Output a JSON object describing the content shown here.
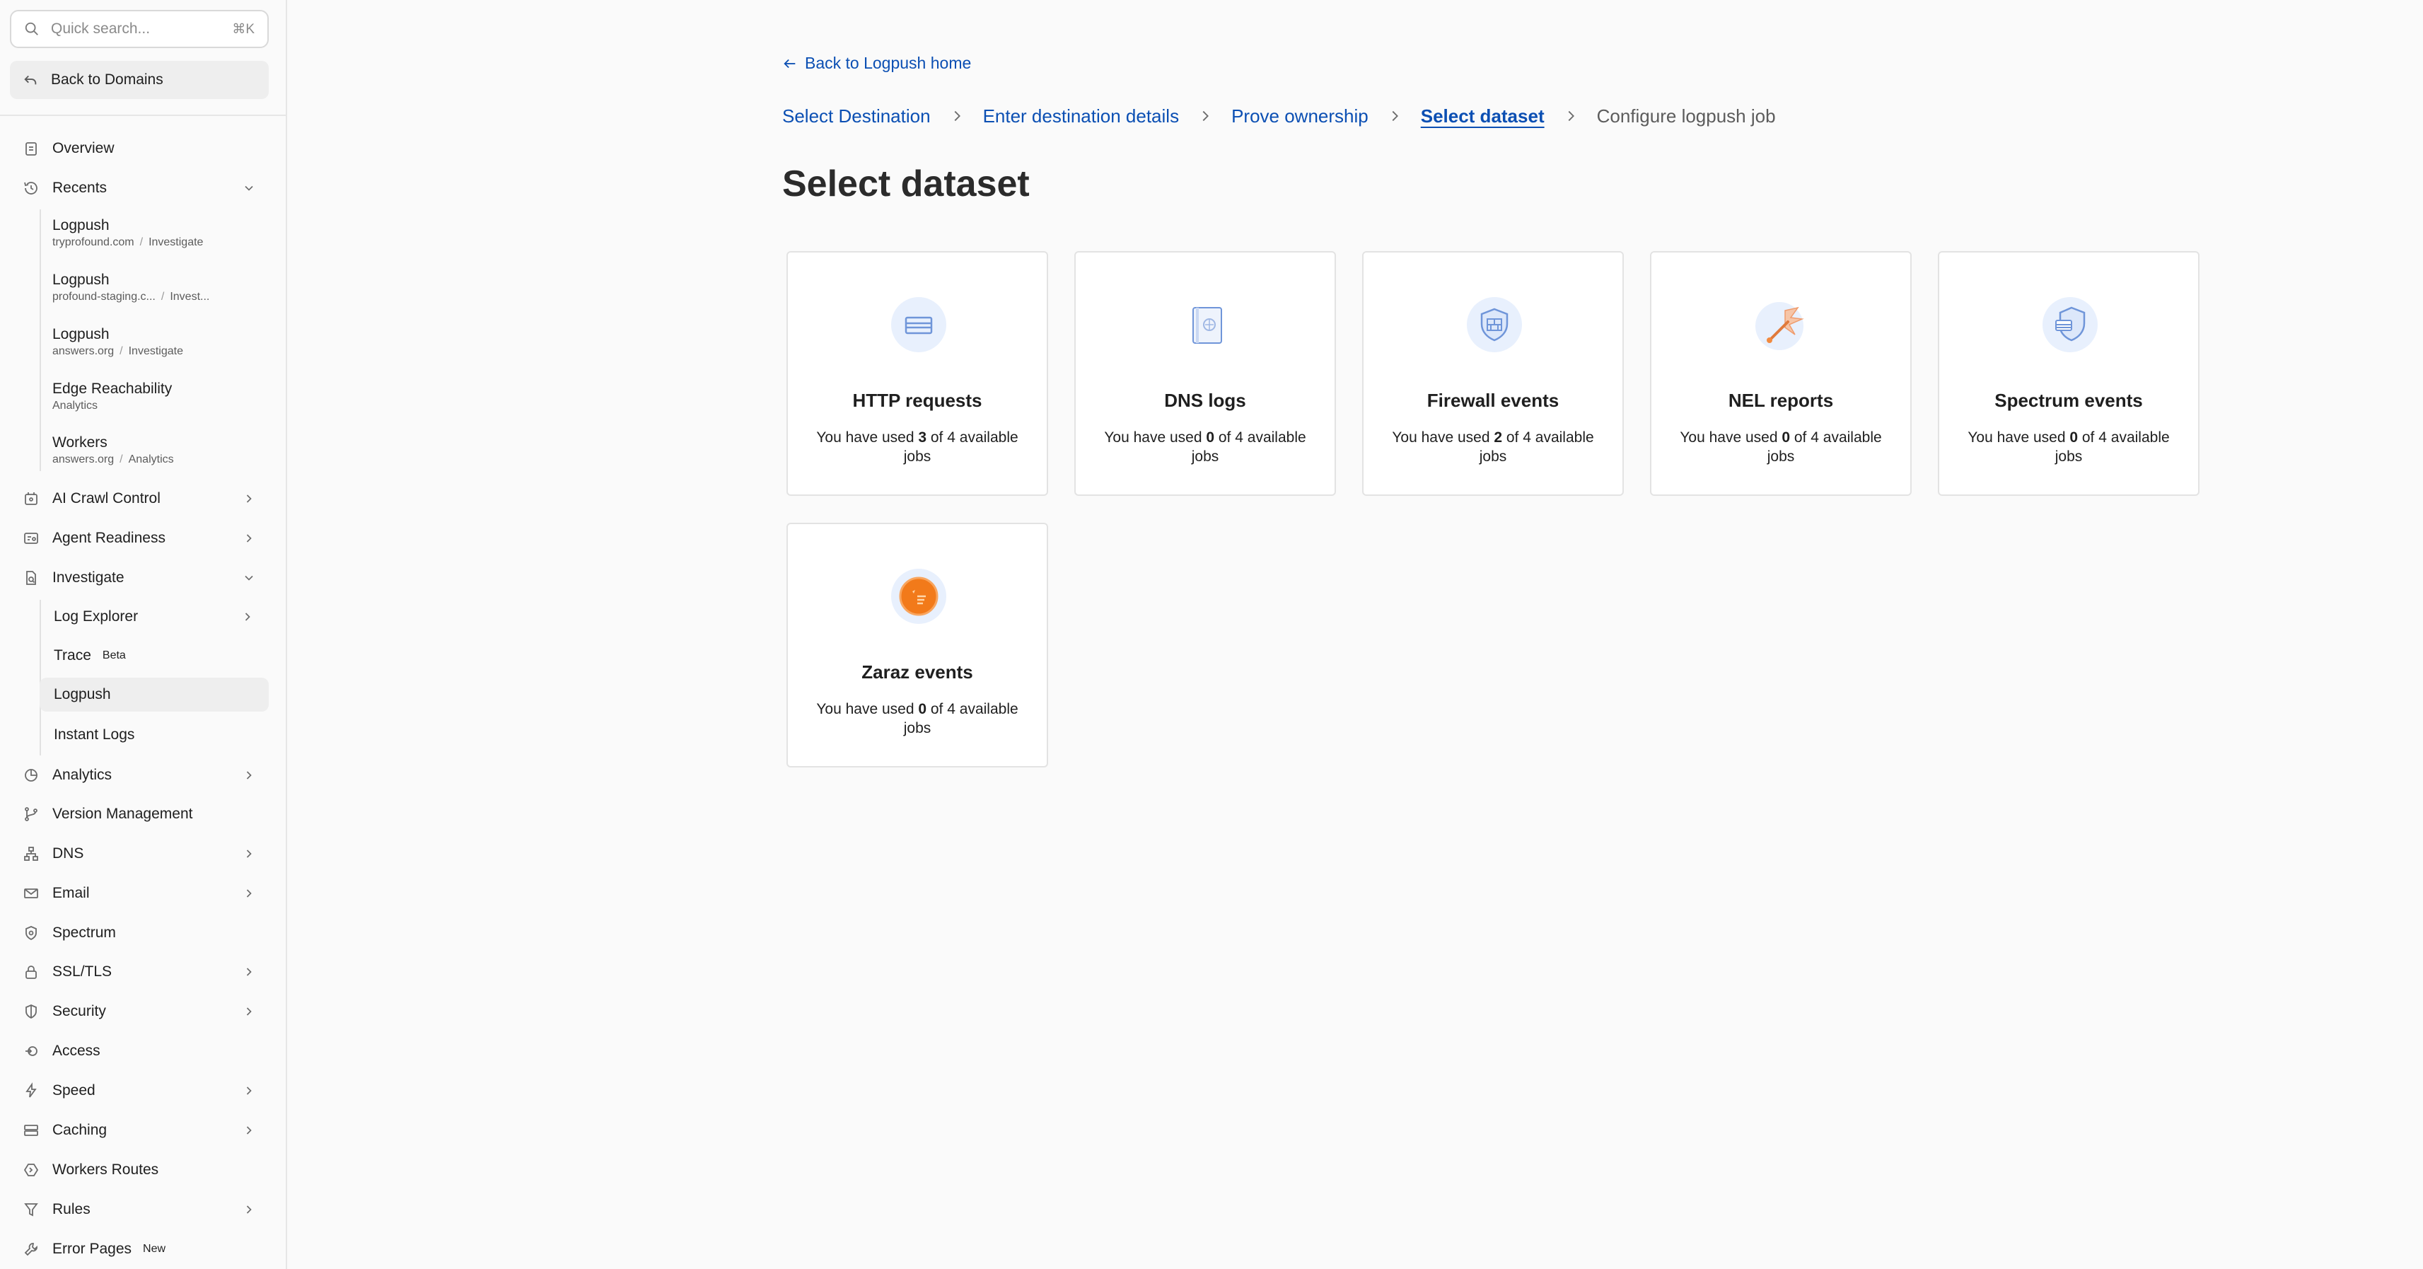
{
  "sidebar": {
    "search": {
      "placeholder": "Quick search...",
      "shortcut": "⌘K"
    },
    "back_to_domains": "Back to Domains",
    "overview": "Overview",
    "recents": {
      "label": "Recents",
      "items": [
        {
          "title": "Logpush",
          "domain": "tryprofound.com",
          "section": "Investigate"
        },
        {
          "title": "Logpush",
          "domain": "profound-staging.c...",
          "section": "Invest..."
        },
        {
          "title": "Logpush",
          "domain": "answers.org",
          "section": "Investigate"
        },
        {
          "title": "Edge Reachability",
          "domain": "",
          "section": "Analytics"
        },
        {
          "title": "Workers",
          "domain": "answers.org",
          "section": "Analytics"
        }
      ]
    },
    "ai_crawl_control": "AI Crawl Control",
    "agent_readiness": "Agent Readiness",
    "investigate": {
      "label": "Investigate",
      "children": {
        "log_explorer": "Log Explorer",
        "trace": "Trace",
        "trace_badge": "Beta",
        "logpush": "Logpush",
        "instant_logs": "Instant Logs"
      }
    },
    "analytics": "Analytics",
    "version_management": "Version Management",
    "dns": "DNS",
    "email": "Email",
    "spectrum": "Spectrum",
    "ssl_tls": "SSL/TLS",
    "security": "Security",
    "access": "Access",
    "speed": "Speed",
    "caching": "Caching",
    "workers_routes": "Workers Routes",
    "rules": "Rules",
    "error_pages": "Error Pages",
    "error_pages_badge": "New"
  },
  "main": {
    "back_link": "Back to Logpush home",
    "steps": [
      {
        "label": "Select Destination"
      },
      {
        "label": "Enter destination details"
      },
      {
        "label": "Prove ownership"
      },
      {
        "label": "Select dataset"
      },
      {
        "label": "Configure logpush job"
      }
    ],
    "title": "Select dataset",
    "usage_prefix": "You have used",
    "usage_of": "of",
    "usage_suffix": "available jobs",
    "datasets": [
      {
        "name": "HTTP requests",
        "used": "3",
        "total": "4",
        "icon": "http-requests-icon"
      },
      {
        "name": "DNS logs",
        "used": "0",
        "total": "4",
        "icon": "dns-logs-icon"
      },
      {
        "name": "Firewall events",
        "used": "2",
        "total": "4",
        "icon": "firewall-icon"
      },
      {
        "name": "NEL reports",
        "used": "0",
        "total": "4",
        "icon": "nel-reports-icon"
      },
      {
        "name": "Spectrum events",
        "used": "0",
        "total": "4",
        "icon": "spectrum-icon"
      },
      {
        "name": "Zaraz events",
        "used": "0",
        "total": "4",
        "icon": "zaraz-icon"
      }
    ]
  },
  "colors": {
    "link_blue": "#0b4fb3",
    "icon_bg": "#e6effc",
    "icon_blue": "#6f95d9",
    "zaraz_orange": "#f27a1a"
  }
}
